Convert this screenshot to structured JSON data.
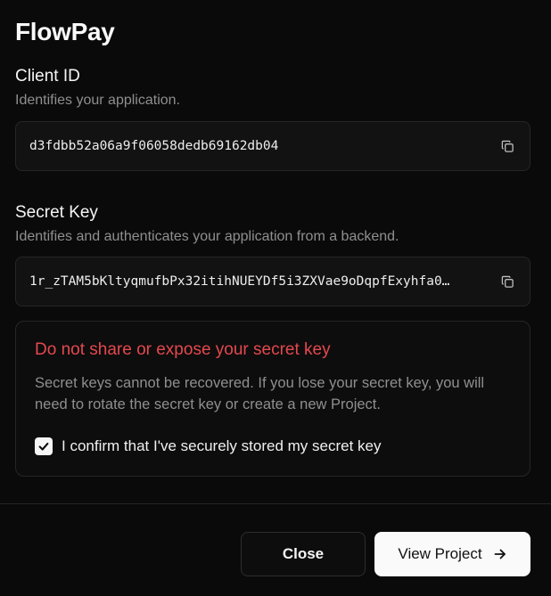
{
  "app": {
    "title": "FlowPay"
  },
  "client_id": {
    "label": "Client ID",
    "description": "Identifies your application.",
    "value": "d3fdbb52a06a9f06058dedb69162db04",
    "copy_icon": "copy-icon"
  },
  "secret_key": {
    "label": "Secret Key",
    "description": "Identifies and authenticates your application from a backend.",
    "value": "1r_zTAM5bKltyqmufbPx32itihNUEYDf5i3ZXVae9oDqpfExyhfa0…",
    "copy_icon": "copy-icon"
  },
  "warning": {
    "title": "Do not share or expose your secret key",
    "text": "Secret keys cannot be recovered. If you lose your secret key, you will need to rotate the secret key or create a new Project.",
    "confirm_label": "I confirm that I've securely stored my secret key",
    "confirmed": true,
    "title_color": "#e5484d"
  },
  "footer": {
    "close_label": "Close",
    "primary_label": "View Project",
    "primary_icon": "arrow-right-icon"
  }
}
